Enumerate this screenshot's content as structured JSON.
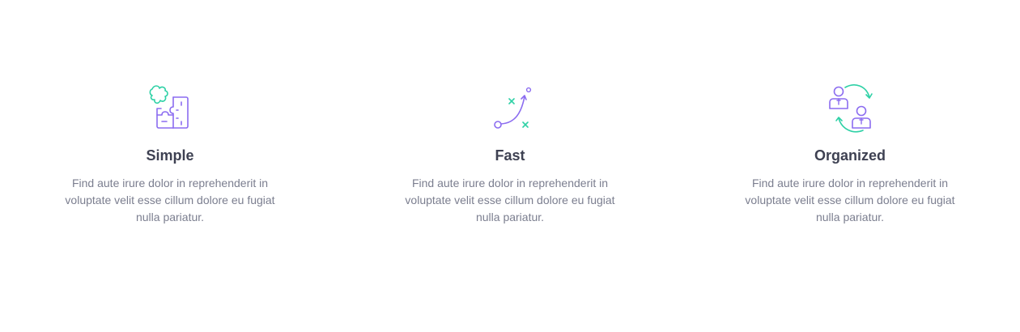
{
  "colors": {
    "purple": "#8b6cf0",
    "green": "#2fd1a6",
    "title": "#3e4152",
    "text": "#7b7e8f"
  },
  "features": [
    {
      "icon": "puzzle-icon",
      "title": "Simple",
      "description": "Find aute irure dolor in reprehenderit in voluptate velit esse cillum dolore eu fugiat nulla pariatur."
    },
    {
      "icon": "strategy-path-icon",
      "title": "Fast",
      "description": "Find aute irure dolor in reprehenderit in voluptate velit esse cillum dolore eu fugiat nulla pariatur."
    },
    {
      "icon": "people-exchange-icon",
      "title": "Organized",
      "description": "Find aute irure dolor in reprehenderit in voluptate velit esse cillum dolore eu fugiat nulla pariatur."
    }
  ]
}
